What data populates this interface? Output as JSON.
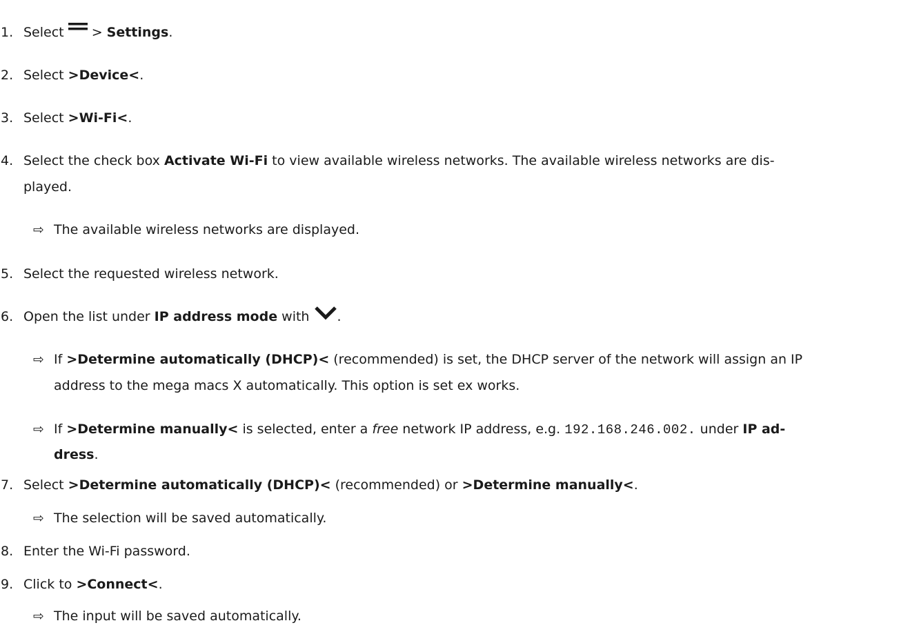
{
  "steps": [
    {
      "num": "1.",
      "t1": "Select ",
      "menu_icon": "hamburger-menu-icon",
      "t2": " > ",
      "b1": "Settings",
      "t3": "."
    },
    {
      "num": "2.",
      "t1": "Select ",
      "b1": ">Device<",
      "t2": "."
    },
    {
      "num": "3.",
      "t1": "Select ",
      "b1": ">Wi-Fi<",
      "t2": "."
    },
    {
      "num": "4.",
      "t1": "Select the check box ",
      "b1": "Activate Wi-Fi",
      "t2": " to view available wireless networks. The available wireless networks are dis-",
      "t3": "played."
    },
    {
      "num": "5.",
      "t1": "Select the requested wireless network."
    },
    {
      "num": "6.",
      "t1": "Open the list under ",
      "b1": "IP address mode",
      "t2": " with ",
      "chevron_icon": "chevron-down-icon",
      "t3": "."
    },
    {
      "num": "7.",
      "t1": "Select ",
      "b1": ">Determine automatically (DHCP)<",
      "t2": " (recommended) or ",
      "b2": ">Determine manually<",
      "t3": "."
    },
    {
      "num": "8.",
      "t1": "Enter the Wi-Fi password."
    },
    {
      "num": "9.",
      "t1": "Click to ",
      "b1": ">Connect<",
      "t2": "."
    }
  ],
  "results": {
    "arrow": "⇨",
    "r4": "The available wireless networks are displayed.",
    "r6a": {
      "t1": "If ",
      "b1": ">Determine automatically (DHCP)<",
      "t2": " (recommended) is set, the DHCP server of the network will assign an IP",
      "t3": "address to the mega macs X automatically. This option is set ex works."
    },
    "r6b": {
      "t1": "If ",
      "b1": ">Determine manually<",
      "t2": " is selected, enter a ",
      "i1": "free",
      "t3": " network IP address, e.g. ",
      "mono": "192.168.246.002.",
      "t4": " under ",
      "b2": "IP ad-",
      "b3": "dress",
      "t5": "."
    },
    "r7": "The selection will be saved automatically.",
    "r9": "The input will be saved automatically."
  }
}
